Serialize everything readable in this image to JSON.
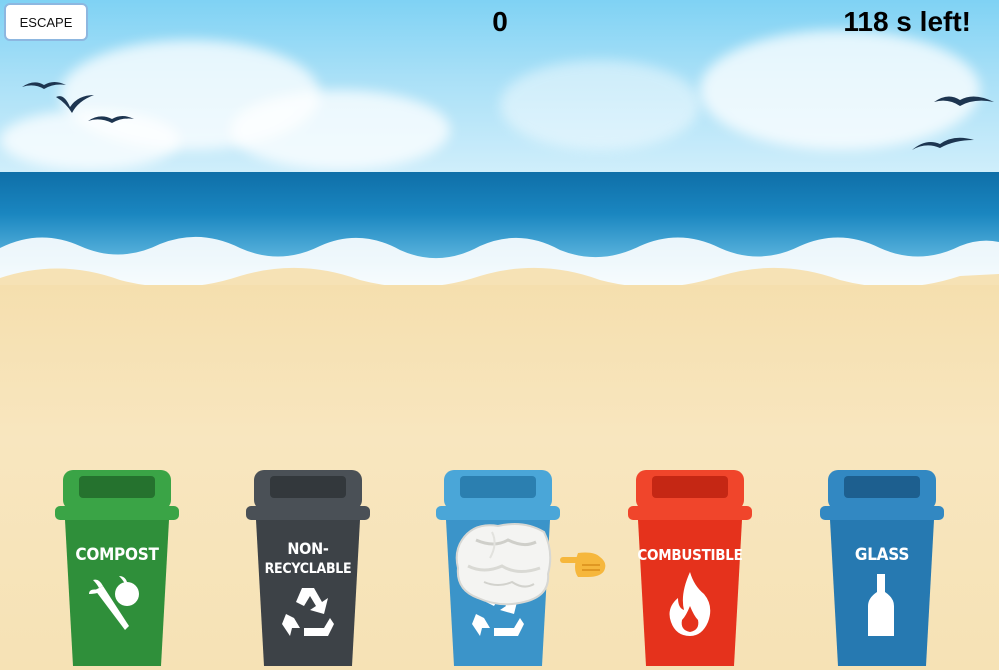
{
  "hud": {
    "escape_label": "ESCAPE",
    "score": "0",
    "timer": "118 s left!"
  },
  "bins": [
    {
      "line1": "COMPOST",
      "line2": "",
      "color": "#2f8f3a",
      "lid": "#3aa446",
      "icon": "vegetable-icon"
    },
    {
      "line1": "NON-",
      "line2": "RECYCLABLE",
      "color": "#3d4247",
      "lid": "#4a5056",
      "icon": "recycle-icon"
    },
    {
      "line1": "",
      "line2": "",
      "color": "#3b94c9",
      "lid": "#4aa6d8",
      "icon": "recycle-icon"
    },
    {
      "line1": "COMBUSTIBLE",
      "line2": "",
      "color": "#e5321c",
      "lid": "#f0452b",
      "icon": "flame-icon"
    },
    {
      "line1": "GLASS",
      "line2": "",
      "color": "#2679b1",
      "lid": "#3288c2",
      "icon": "bottle-icon"
    }
  ],
  "held_item": "crumpled-paper",
  "pointer_icon": "pointing-hand-icon"
}
